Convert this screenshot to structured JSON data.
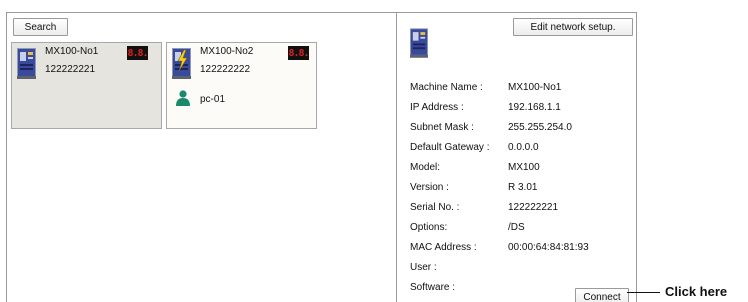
{
  "left_panel": {
    "search_label": "Search",
    "devices": [
      {
        "name": "MX100-No1",
        "serial": "122222221",
        "display": "8.8.",
        "selected": true
      },
      {
        "name": "MX100-No2",
        "serial": "122222222",
        "display": "8.8.",
        "selected": false,
        "user": "pc-01"
      }
    ]
  },
  "right_panel": {
    "edit_label": "Edit network setup.",
    "details": [
      {
        "label": "Machine Name :",
        "value": "MX100-No1"
      },
      {
        "label": "IP Address :",
        "value": "192.168.1.1"
      },
      {
        "label": "Subnet Mask :",
        "value": "255.255.254.0"
      },
      {
        "label": "Default Gateway :",
        "value": "0.0.0.0"
      },
      {
        "label": "Model:",
        "value": "MX100"
      },
      {
        "label": "Version :",
        "value": "R 3.01"
      },
      {
        "label": "Serial No. :",
        "value": "122222221"
      },
      {
        "label": "Options:",
        "value": "/DS"
      },
      {
        "label": "MAC Address :",
        "value": "00:00:64:84:81:93"
      },
      {
        "label": "User :",
        "value": ""
      },
      {
        "label": "Software :",
        "value": ""
      }
    ],
    "connect_label": "Connect"
  },
  "annotation": {
    "text": "Click here"
  },
  "colors": {
    "selected_card_bg": "#e6e4de",
    "card_bg": "#fcfbf7",
    "segment_red": "#e02020",
    "user_icon": "#1a8a6a",
    "device_blue": "#3a4a9a"
  },
  "icons": {
    "device": "mx100-device-icon",
    "network_connect": "lightning-icon",
    "user": "user-icon"
  }
}
